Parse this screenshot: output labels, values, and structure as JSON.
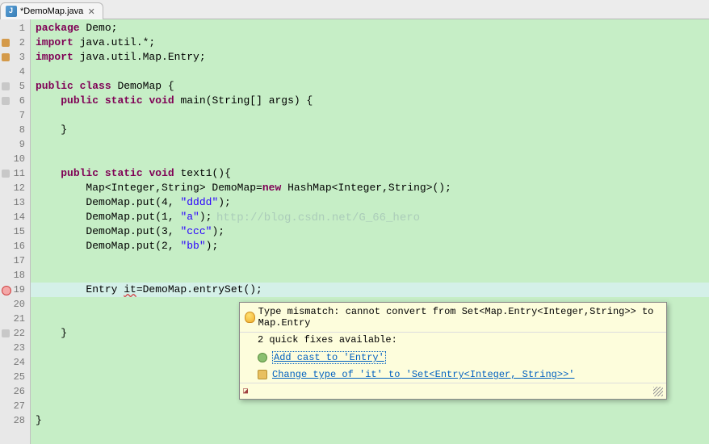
{
  "tab": {
    "title": "*DemoMap.java",
    "close": "✕"
  },
  "gutter": {
    "lines": [
      1,
      2,
      3,
      4,
      5,
      6,
      7,
      8,
      9,
      10,
      11,
      12,
      13,
      14,
      15,
      16,
      17,
      18,
      19,
      20,
      21,
      22,
      23,
      24,
      25,
      26,
      27,
      28
    ],
    "importMarkers": [
      2,
      3
    ],
    "foldMarkers": [
      5,
      6,
      11,
      22
    ],
    "errorMarkers": [
      19
    ]
  },
  "code": {
    "l1": {
      "pre": "",
      "kw1": "package",
      "mid": " Demo;"
    },
    "l2": {
      "pre": "",
      "kw1": "import",
      "mid": " java.util.*;"
    },
    "l3": {
      "pre": "",
      "kw1": "import",
      "mid": " java.util.Map.Entry;"
    },
    "l4": "",
    "l5": {
      "pre": "",
      "kw1": "public",
      "sp1": " ",
      "kw2": "class",
      "mid": " DemoMap {"
    },
    "l6": {
      "pre": "    ",
      "kw1": "public",
      "sp1": " ",
      "kw2": "static",
      "sp2": " ",
      "kw3": "void",
      "mid": " main(String[] args) {"
    },
    "l7": "",
    "l8": "    }",
    "l9": "",
    "l10": "",
    "l11": {
      "pre": "    ",
      "kw1": "public",
      "sp1": " ",
      "kw2": "static",
      "sp2": " ",
      "kw3": "void",
      "mid": " text1(){"
    },
    "l12": {
      "pre": "        Map<Integer,String> DemoMap=",
      "kw1": "new",
      "mid": " HashMap<Integer,String>();"
    },
    "l13": {
      "pre": "        DemoMap.put(4, ",
      "str": "\"dddd\"",
      "post": ");"
    },
    "l14": {
      "pre": "        DemoMap.put(1, ",
      "str": "\"a\"",
      "post": ");"
    },
    "l15": {
      "pre": "        DemoMap.put(3, ",
      "str": "\"ccc\"",
      "post": ");"
    },
    "l16": {
      "pre": "        DemoMap.put(2, ",
      "str": "\"bb\"",
      "post": ");"
    },
    "l17": "",
    "l18": "",
    "l19": {
      "pre": "        Entry ",
      "err": "it",
      "post": "=DemoMap.entrySet();"
    },
    "l20": "",
    "l21": "",
    "l22": "    }",
    "l23": "",
    "l24": "",
    "l25": "",
    "l26": "",
    "l27": "",
    "l28": "}"
  },
  "watermark": "http://blog.csdn.net/G_66_hero",
  "tooltip": {
    "header": "Type mismatch: cannot convert from Set<Map.Entry<Integer,String>> to Map.Entry",
    "sub": "2 quick fixes available:",
    "fix1": "Add cast to 'Entry'",
    "fix2": "Change type of 'it' to 'Set<Entry<Integer, String>>'"
  }
}
